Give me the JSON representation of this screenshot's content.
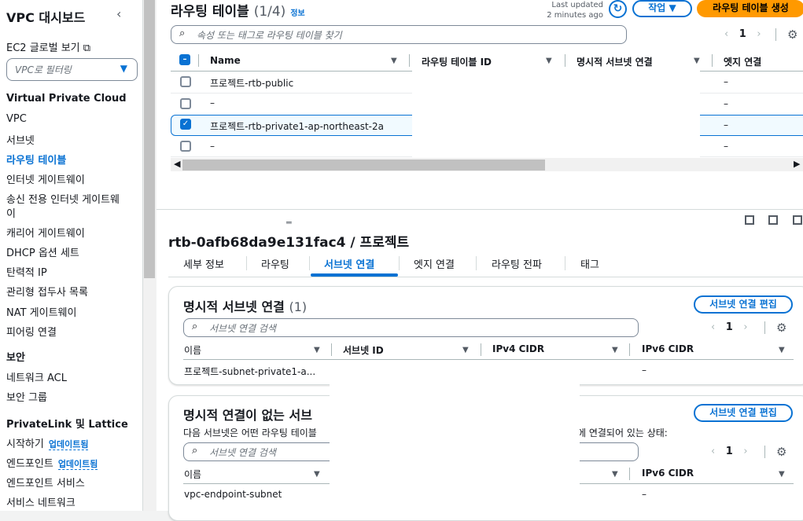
{
  "sidebar": {
    "title": "VPC 대시보드",
    "ec2_global": "EC2 글로벌 보기",
    "filter_placeholder": "VPC로 필터링",
    "section_vpc": "Virtual Private Cloud",
    "items": [
      "VPC",
      "서브넷",
      "라우팅 테이블",
      "인터넷 게이트웨이",
      "송신 전용 인터넷 게이트웨",
      "이",
      "캐리어 게이트웨이",
      "DHCP 옵션 세트",
      "탄력적 IP",
      "관리형 접두사 목록",
      "NAT 게이트웨이",
      "피어링 연결"
    ],
    "section_security": "보안",
    "security_items": [
      "네트워크 ACL",
      "보안 그룹"
    ],
    "section_privatelink": "PrivateLink 및 Lattice",
    "privatelink_items": [
      "시작하기",
      "엔드포인트",
      "엔드포인트 서비스",
      "서비스 네트워크"
    ],
    "badge": "업데이트됨"
  },
  "table": {
    "title": "라우팅 테이블",
    "count": "(1/4)",
    "info": "정보",
    "last_updated_1": "Last updated",
    "last_updated_2": "2 minutes ago",
    "refresh_icon": "↻",
    "action_label": "작업 ▼",
    "create_label": "라우팅 테이블 생성",
    "search_placeholder": "속성 또는 태그로 라우팅 테이블 찾기",
    "page": "1",
    "columns": [
      "Name",
      "라우팅 테이블 ID",
      "명시적 서브넷 연결",
      "엣지 연결"
    ],
    "rows": [
      {
        "name": "프로젝트-rtb-public",
        "edge": "–",
        "checked": false
      },
      {
        "name": "–",
        "edge": "–",
        "checked": false
      },
      {
        "name": "프로젝트-rtb-private1-ap-northeast-2a",
        "edge": "–",
        "checked": true
      },
      {
        "name": "–",
        "edge": "–",
        "checked": false
      }
    ]
  },
  "detail": {
    "title": "rtb-0afb68da9e131fac4 / 프로젝트",
    "tabs": [
      "세부 정보",
      "라우팅",
      "서브넷 연결",
      "엣지 연결",
      "라우팅 전파",
      "태그"
    ],
    "active_tab": "서브넷 연결",
    "explicit": {
      "title": "명시적 서브넷 연결",
      "count": "(1)",
      "edit_label": "서브넷 연결 편집",
      "search_placeholder": "서브넷 연결 검색",
      "page": "1",
      "columns": [
        "이름",
        "서브넷 ID",
        "IPv4 CIDR",
        "IPv6 CIDR"
      ],
      "row": {
        "name": "프로젝트-subnet-private1-a...",
        "ipv6": "–"
      }
    },
    "implicit": {
      "title": "명시적 연결이 없는 서브",
      "edit_label": "서브넷 연결 편집",
      "desc_left": "다음 서브넷은 어떤 라우팅 테이블",
      "desc_right": "에 연결되어 있는 상태:",
      "search_placeholder": "서브넷 연결 검색",
      "page": "1",
      "columns": [
        "이름",
        "IPv6 CIDR"
      ],
      "row": {
        "name": "vpc-endpoint-subnet",
        "ipv6": "–"
      }
    }
  }
}
